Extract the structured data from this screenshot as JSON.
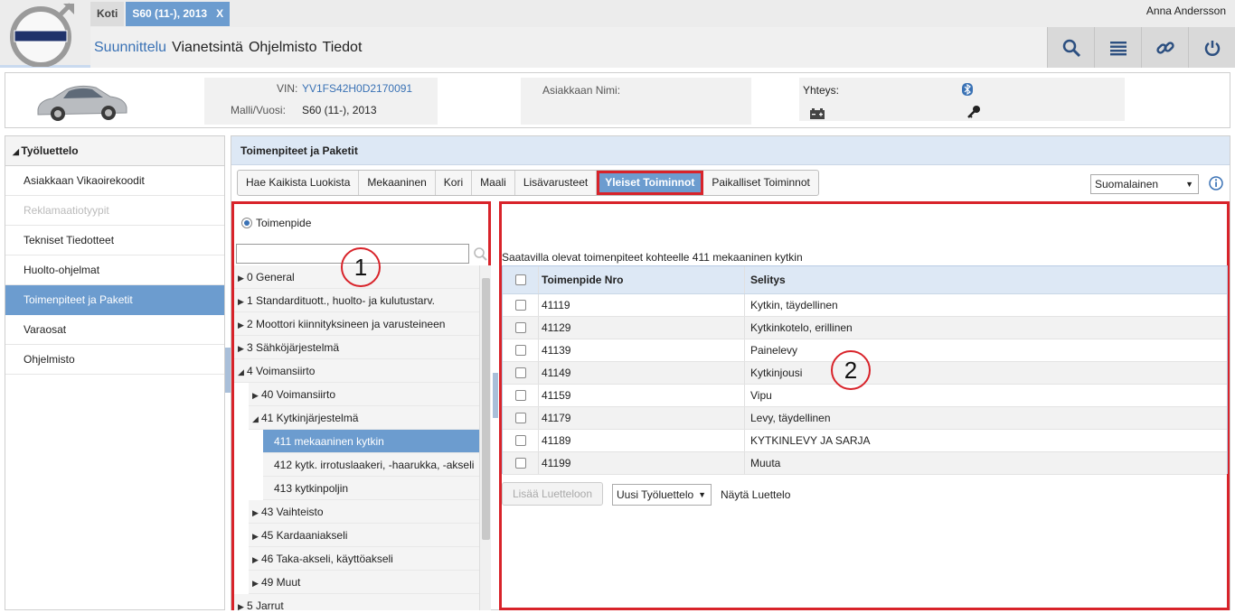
{
  "header": {
    "tabs": [
      {
        "label": "Koti"
      },
      {
        "label": "S60 (11-), 2013",
        "close": "X"
      }
    ],
    "user": "Anna Andersson",
    "nav": [
      "Suunnittelu",
      "Vianetsintä",
      "Ohjelmisto",
      "Tiedot"
    ]
  },
  "vehicle": {
    "vin_label": "VIN:",
    "vin": "YV1FS42H0D2170091",
    "model_label": "Malli/Vuosi:",
    "model": "S60 (11-), 2013",
    "customer_label": "Asiakkaan Nimi:",
    "connection_label": "Yhteys:"
  },
  "sidebar": {
    "header": "Työluettelo",
    "items": [
      {
        "label": "Asiakkaan Vikaoirekoodit",
        "state": "normal"
      },
      {
        "label": "Reklamaatiotyypit",
        "state": "disabled"
      },
      {
        "label": "Tekniset Tiedotteet",
        "state": "normal"
      },
      {
        "label": "Huolto-ohjelmat",
        "state": "normal"
      },
      {
        "label": "Toimenpiteet ja Paketit",
        "state": "active"
      },
      {
        "label": "Varaosat",
        "state": "normal"
      },
      {
        "label": "Ohjelmisto",
        "state": "normal"
      }
    ]
  },
  "panel": {
    "title": "Toimenpiteet ja Paketit",
    "category_tabs": [
      "Hae Kaikista Luokista",
      "Mekaaninen",
      "Kori",
      "Maali",
      "Lisävarusteet",
      "Yleiset Toiminnot",
      "Paikalliset Toiminnot"
    ],
    "active_tab": "Yleiset Toiminnot",
    "language": "Suomalainen"
  },
  "tree": {
    "radio_label": "Toimenpide",
    "search_value": "",
    "nodes": [
      {
        "label": "0 General",
        "level": 0,
        "expander": "▶"
      },
      {
        "label": "1 Standardituott., huolto- ja kulutustarv.",
        "level": 0,
        "expander": "▶"
      },
      {
        "label": "2 Moottori kiinnityksineen ja varusteineen",
        "level": 0,
        "expander": "▶"
      },
      {
        "label": "3 Sähköjärjestelmä",
        "level": 0,
        "expander": "▶"
      },
      {
        "label": "4 Voimansiirto",
        "level": 0,
        "expander": "◢"
      },
      {
        "label": "40 Voimansiirto",
        "level": 1,
        "expander": "▶"
      },
      {
        "label": "41 Kytkinjärjestelmä",
        "level": 1,
        "expander": "◢"
      },
      {
        "label": "411 mekaaninen kytkin",
        "level": 2,
        "expander": "",
        "selected": true
      },
      {
        "label": "412 kytk. irrotuslaakeri, -haarukka, -akseli",
        "level": 2,
        "expander": ""
      },
      {
        "label": "413 kytkinpoljin",
        "level": 2,
        "expander": ""
      },
      {
        "label": "43 Vaihteisto",
        "level": 1,
        "expander": "▶"
      },
      {
        "label": "45 Kardaaniakseli",
        "level": 1,
        "expander": "▶"
      },
      {
        "label": "46 Taka-akseli, käyttöakseli",
        "level": 1,
        "expander": "▶"
      },
      {
        "label": "49 Muut",
        "level": 1,
        "expander": "▶"
      },
      {
        "label": "5 Jarrut",
        "level": 0,
        "expander": "▶"
      }
    ]
  },
  "operations": {
    "available_text": "Saatavilla olevat toimenpiteet kohteelle 411 mekaaninen kytkin",
    "columns": [
      "Toimenpide Nro",
      "Selitys"
    ],
    "rows": [
      {
        "nro": "41119",
        "desc": "Kytkin, täydellinen"
      },
      {
        "nro": "41129",
        "desc": "Kytkinkotelo, erillinen"
      },
      {
        "nro": "41139",
        "desc": "Painelevy"
      },
      {
        "nro": "41149",
        "desc": "Kytkinjousi"
      },
      {
        "nro": "41159",
        "desc": "Vipu"
      },
      {
        "nro": "41179",
        "desc": "Levy, täydellinen"
      },
      {
        "nro": "41189",
        "desc": "KYTKINLEVY JA SARJA"
      },
      {
        "nro": "41199",
        "desc": "Muuta"
      }
    ],
    "add_button": "Lisää Luetteloon",
    "list_select": "Uusi Työluettelo",
    "show_list": "Näytä Luettelo"
  },
  "annotations": [
    "1",
    "2"
  ],
  "colors": {
    "accent": "#6c9ccf",
    "highlight": "#d8232a",
    "link": "#3a72b5"
  }
}
